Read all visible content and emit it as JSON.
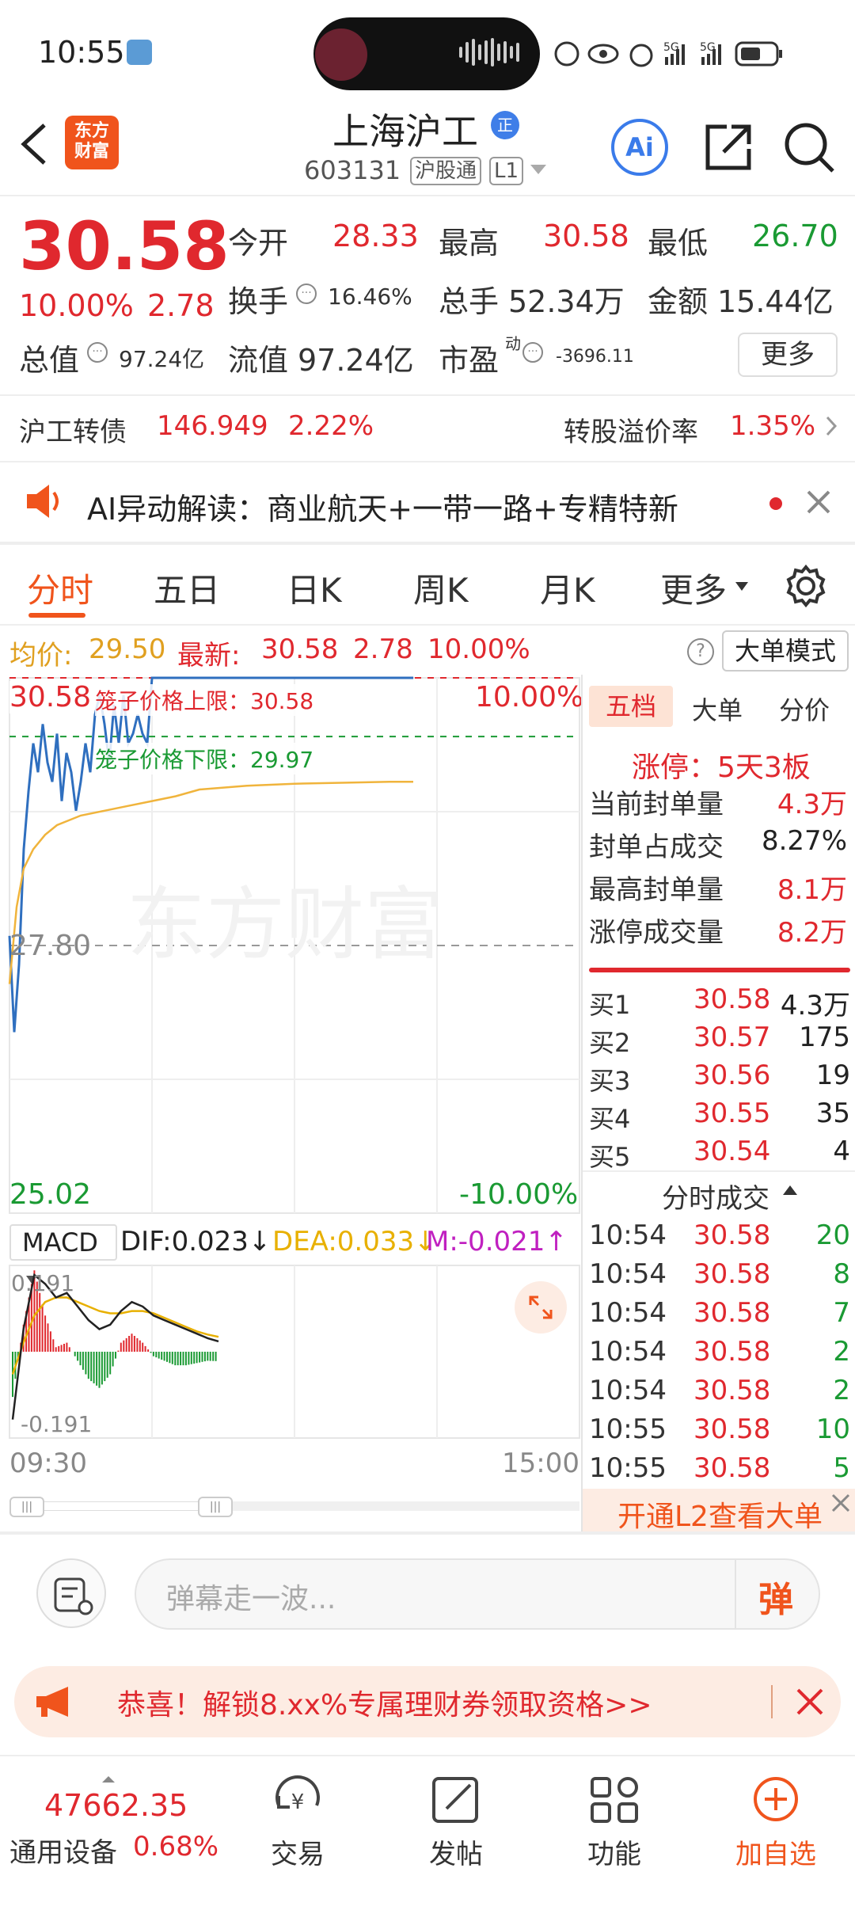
{
  "status_bar": {
    "time": "10:55",
    "network1": "5G",
    "network2": "5G"
  },
  "header": {
    "logo_line1": "东方",
    "logo_line2": "财富",
    "stock_name": "上海沪工",
    "badge": "正",
    "stock_code": "603131",
    "tag_connect": "沪股通",
    "tag_level": "L1",
    "ai_label": "Ai"
  },
  "quote": {
    "price": "30.58",
    "change_pct": "10.00%",
    "change_amt": "2.78",
    "open_label": "今开",
    "open": "28.33",
    "high_label": "最高",
    "high": "30.58",
    "low_label": "最低",
    "low": "26.70",
    "turnover_label": "换手",
    "turnover": "16.46%",
    "volume_label": "总手",
    "volume": "52.34万",
    "amount_label": "金额",
    "amount": "15.44亿",
    "mktcap_label": "总值",
    "mktcap": "97.24亿",
    "float_label": "流值",
    "float_val": "97.24亿",
    "pe_label": "市盈",
    "pe_sup": "动",
    "pe": "-3696.11",
    "more_label": "更多"
  },
  "bond": {
    "name": "沪工转债",
    "price": "146.949",
    "pct": "2.22%",
    "premium_label": "转股溢价率",
    "premium": "1.35%"
  },
  "ai_notice": {
    "text": "AI异动解读：商业航天+一带一路+专精特新"
  },
  "tabs": [
    {
      "label": "分时"
    },
    {
      "label": "五日"
    },
    {
      "label": "日K"
    },
    {
      "label": "周K"
    },
    {
      "label": "月K"
    },
    {
      "label": "更多"
    }
  ],
  "chart_info": {
    "avg_label": "均价:",
    "avg": "29.50",
    "latest_label": "最新:",
    "latest": "30.58",
    "chg": "2.78",
    "pct": "10.00%",
    "help": "?",
    "big_mode": "大单模式"
  },
  "chart_data": [
    {
      "type": "line",
      "x_range": [
        "09:30",
        "15:00"
      ],
      "y_axis_labels": {
        "top": "30.58",
        "mid": "27.80",
        "bottom": "25.02",
        "top_pct": "10.00%",
        "bottom_pct": "-10.00%"
      },
      "ylim": [
        25.02,
        30.58
      ],
      "watermark": "东方财富",
      "annotations": [
        {
          "text": "笼子价格上限：30.58",
          "value": 30.58
        },
        {
          "text": "笼子价格下限：29.97",
          "value": 29.97
        }
      ],
      "series": [
        {
          "name": "最新",
          "minutes": [
            0,
            2,
            4,
            6,
            8,
            10,
            12,
            14,
            16,
            18,
            20,
            22,
            24,
            26,
            28,
            30,
            32,
            34,
            36,
            38,
            40,
            42,
            44,
            46,
            48,
            50,
            52,
            54,
            56,
            58,
            60,
            62,
            64,
            66,
            68,
            70,
            75,
            80,
            90,
            100,
            110,
            120,
            130,
            140,
            150,
            160,
            170
          ],
          "values": [
            27.9,
            26.9,
            27.6,
            28.8,
            29.4,
            29.9,
            29.6,
            30.1,
            29.7,
            29.5,
            30.0,
            29.3,
            29.8,
            29.6,
            29.2,
            29.5,
            29.9,
            29.6,
            30.2,
            30.4,
            30.1,
            29.7,
            30.3,
            29.9,
            30.4,
            29.9,
            30.0,
            30.2,
            30.0,
            29.9,
            30.58,
            30.58,
            30.58,
            30.58,
            30.58,
            30.58,
            30.58,
            30.58,
            30.58,
            30.58,
            30.58,
            30.58,
            30.58,
            30.58,
            30.58,
            30.58,
            30.58
          ]
        },
        {
          "name": "均价",
          "minutes": [
            0,
            3,
            6,
            10,
            15,
            20,
            30,
            40,
            50,
            60,
            70,
            80,
            100,
            120,
            140,
            160,
            170
          ],
          "values": [
            27.4,
            28.2,
            28.6,
            28.8,
            28.95,
            29.05,
            29.15,
            29.2,
            29.25,
            29.3,
            29.35,
            29.42,
            29.46,
            29.48,
            29.49,
            29.5,
            29.5
          ]
        }
      ]
    },
    {
      "type": "bar",
      "indicator": "MACD",
      "dif_label": "DIF:0.023↓",
      "dea_label": "DEA:0.033↓",
      "m_label": "M:-0.021↑",
      "y_axis_labels": {
        "top": "0.191",
        "bottom": "-0.191"
      },
      "ylim": [
        -0.191,
        0.191
      ],
      "x_labels": [
        "09:30",
        "15:00"
      ],
      "dif": [
        -0.15,
        0.05,
        0.17,
        0.15,
        0.12,
        0.13,
        0.1,
        0.07,
        0.05,
        0.06,
        0.09,
        0.11,
        0.1,
        0.08,
        0.07,
        0.06,
        0.05,
        0.04,
        0.03,
        0.023
      ],
      "dea": [
        -0.05,
        0.02,
        0.08,
        0.11,
        0.12,
        0.12,
        0.11,
        0.1,
        0.09,
        0.085,
        0.085,
        0.09,
        0.09,
        0.085,
        0.075,
        0.065,
        0.055,
        0.045,
        0.038,
        0.033
      ],
      "hist": [
        -0.1,
        0.06,
        0.18,
        0.08,
        0.01,
        0.02,
        -0.02,
        -0.06,
        -0.08,
        -0.05,
        0.02,
        0.04,
        0.02,
        -0.01,
        -0.02,
        -0.03,
        -0.03,
        -0.025,
        -0.02,
        -0.021
      ]
    }
  ],
  "right_panel": {
    "tabs": [
      "五档",
      "大单",
      "分价"
    ],
    "limit_text": "涨停：5天3板",
    "stats": [
      {
        "label": "当前封单量",
        "value": "4.3万",
        "color": "red"
      },
      {
        "label": "封单占成交",
        "value": "8.27%",
        "color": "dark"
      },
      {
        "label": "最高封单量",
        "value": "8.1万",
        "color": "red"
      },
      {
        "label": "涨停成交量",
        "value": "8.2万",
        "color": "red"
      }
    ],
    "bids": [
      {
        "label": "买1",
        "price": "30.58",
        "vol": "4.3万"
      },
      {
        "label": "买2",
        "price": "30.57",
        "vol": "175"
      },
      {
        "label": "买3",
        "price": "30.56",
        "vol": "19"
      },
      {
        "label": "买4",
        "price": "30.55",
        "vol": "35"
      },
      {
        "label": "买5",
        "price": "30.54",
        "vol": "4"
      }
    ],
    "ticks_header": "分时成交",
    "ticks": [
      {
        "time": "10:54",
        "price": "30.58",
        "vol": "20"
      },
      {
        "time": "10:54",
        "price": "30.58",
        "vol": "8"
      },
      {
        "time": "10:54",
        "price": "30.58",
        "vol": "7"
      },
      {
        "time": "10:54",
        "price": "30.58",
        "vol": "2"
      },
      {
        "time": "10:54",
        "price": "30.58",
        "vol": "2"
      },
      {
        "time": "10:55",
        "price": "30.58",
        "vol": "10"
      },
      {
        "time": "10:55",
        "price": "30.58",
        "vol": "5"
      }
    ],
    "l2_text": "开通L2查看大单"
  },
  "danmu": {
    "placeholder": "弹幕走一波...",
    "send": "弹"
  },
  "banner": {
    "text": "恭喜！解锁8.xx%专属理财券领取资格>>"
  },
  "bottom_nav": {
    "index_value": "47662.35",
    "index_name": "通用设备",
    "index_pct": "0.68%",
    "items": [
      {
        "label": "交易"
      },
      {
        "label": "发帖"
      },
      {
        "label": "功能"
      },
      {
        "label": "加自选"
      }
    ]
  },
  "colors": {
    "up": "#e0282e",
    "down": "#1a9a33",
    "accent": "#f0541c",
    "price_line": "#2f6fbf",
    "avg_line": "#f0b43c"
  }
}
